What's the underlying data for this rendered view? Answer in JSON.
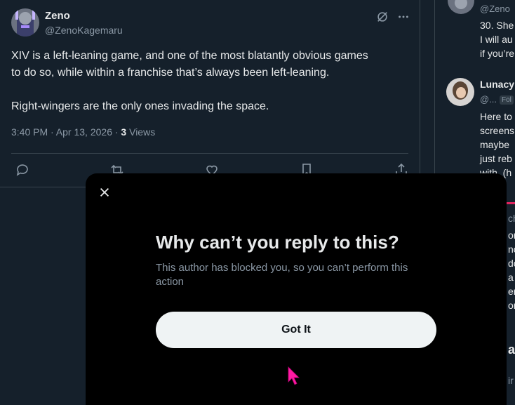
{
  "tweet": {
    "author_name": "Zeno",
    "author_handle": "@ZenoKagemaru",
    "text": "XIV is a left-leaning game, and one of the most blatantly obvious games\nto do so, while within a franchise that’s always been left-leaning.\n\nRight-wingers are the only ones invading the space.",
    "time": "3:40 PM · Apr 13, 2026 · ",
    "views_count": "3",
    "views_label": " Views"
  },
  "side": {
    "reply1_handle": "@Zeno",
    "reply1_lines": [
      "30. She",
      "I will au",
      "if you’re"
    ],
    "reply2_name": "Lunacy",
    "reply2_handle": "@...",
    "reply2_badge": "Fol",
    "reply2_lines": [
      "Here to",
      "screens",
      "maybe",
      "just reb",
      "with. (h"
    ],
    "fragment_lines": [
      "ch",
      "or",
      "nc",
      "do",
      "a ·",
      "er",
      "on"
    ],
    "fragment_bold": "a",
    "fragment_small": "ir"
  },
  "modal": {
    "title": "Why can’t you reply to this?",
    "body": "This author has blocked you, so you can’t perform this action",
    "button_label": "Got It"
  },
  "colors": {
    "background": "#15202b",
    "modal_bg": "#000000",
    "button_bg": "#eff3f4",
    "muted_text": "#8b98a5",
    "cursor": "#ff1aa3"
  }
}
